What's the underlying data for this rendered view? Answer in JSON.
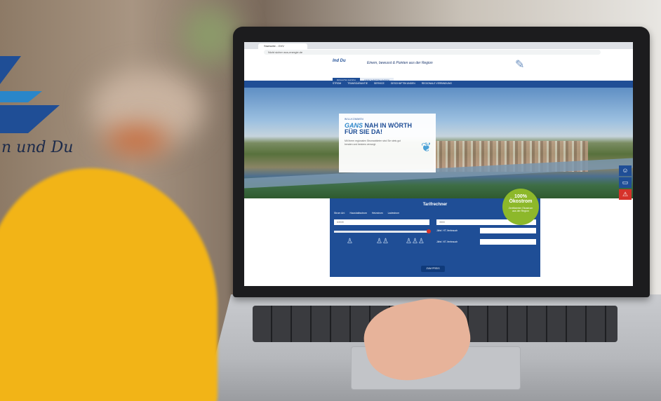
{
  "brandmark": {
    "text": "n und Du",
    "color": "#1f4e96"
  },
  "browser": {
    "tab_title": "Startseite - GVV",
    "url": "Nicht sicher   wcs-energie.de"
  },
  "site": {
    "logo_text": "Ind Du",
    "slogan": "Einem, bewusst & Pointen aus der Region",
    "segment_tabs": [
      "PRIVATKUNDEN",
      "GESCHÄFTSKUNDEN"
    ],
    "nav_items": [
      "STROM",
      "TRANSGARANTIE",
      "SERVICE",
      "GESCHÄFTSKUNDEN",
      "REGIONALE VERBINDUNG"
    ]
  },
  "hero_card": {
    "kicker": "WILLKOMMEN",
    "title_em": "GANS",
    "title_rest": " NAH IN WÖRTH",
    "title_line2": "FÜR SIE DA!",
    "body": "Mit Ihrem regionalen Stromanbieter sind Sie stets gut beraten und bestens versorgt."
  },
  "tarifrechner": {
    "title": "Tarifrechner",
    "options": [
      "Strom Art:",
      "Haushaltsstrom",
      "Heizstrom",
      "Ladestrom"
    ],
    "plz_placeholder": "63939",
    "verbrauch_value": "3500",
    "label_ht": "Jährl. HT-Verbrauch",
    "label_nt": "Jährl. NT-Verbrauch",
    "button": "ZUM PREIS"
  },
  "eco_badge": {
    "big": "100%\nÖkostrom",
    "small": "Zertifizierter Ökostrom\naus der Region"
  },
  "colors": {
    "brand_blue": "#1f4e96",
    "eco_green": "#8db82a",
    "alert_red": "#d6322a"
  }
}
